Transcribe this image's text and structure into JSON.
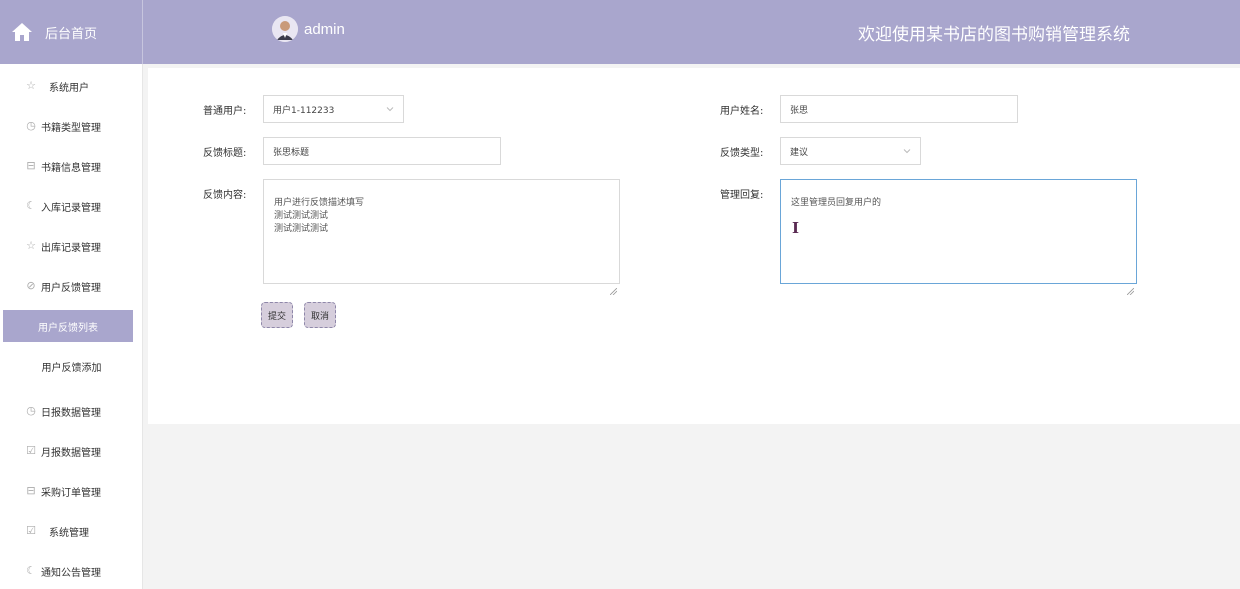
{
  "header": {
    "home_label": "后台首页",
    "user_name": "admin",
    "system_title": "欢迎使用某书店的图书购销管理系统"
  },
  "sidebar": {
    "items": [
      {
        "label": "系统用户",
        "icon": "star-outline-icon"
      },
      {
        "label": "书籍类型管理",
        "icon": "clock-icon"
      },
      {
        "label": "书籍信息管理",
        "icon": "box-icon"
      },
      {
        "label": "入库记录管理",
        "icon": "moon-icon"
      },
      {
        "label": "出库记录管理",
        "icon": "star-outline-icon"
      },
      {
        "label": "用户反馈管理",
        "icon": "compass-icon"
      },
      {
        "label": "用户反馈列表",
        "icon": ""
      },
      {
        "label": "用户反馈添加",
        "icon": ""
      },
      {
        "label": "日报数据管理",
        "icon": "clock-icon"
      },
      {
        "label": "月报数据管理",
        "icon": "calendar-icon"
      },
      {
        "label": "采购订单管理",
        "icon": "box-icon"
      },
      {
        "label": "系统管理",
        "icon": "calendar-icon"
      },
      {
        "label": "通知公告管理",
        "icon": "moon-icon"
      }
    ]
  },
  "form": {
    "user_label": "普通用户:",
    "user_value": "用户1-112233",
    "name_label": "用户姓名:",
    "name_value": "张思",
    "title_label": "反馈标题:",
    "title_value": "张思标题",
    "type_label": "反馈类型:",
    "type_value": "建议",
    "content_label": "反馈内容:",
    "content_value": "用户进行反馈描述填写\n测试测试测试\n测试测试测试",
    "reply_label": "管理回复:",
    "reply_value": "这里管理员回复用户的",
    "submit_label": "提交",
    "cancel_label": "取消"
  },
  "colors": {
    "header_bg": "#a9a6cd",
    "active_item_bg": "#a9a6cd",
    "focus_border": "#6aa6d8"
  }
}
